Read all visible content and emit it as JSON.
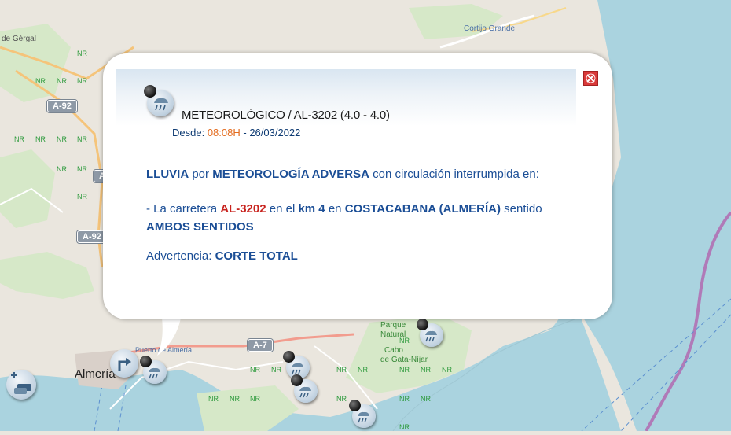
{
  "map": {
    "labels": [
      "de Gérgal",
      "Cortijo Grande",
      "Almería",
      "Puerto de Almería",
      "Parque",
      "Natural",
      "Cabo",
      "de Gata-Níjar"
    ],
    "road_shields": [
      "A-92",
      "A-92",
      "A-7",
      "A"
    ],
    "nr_label": "NR",
    "colors": {
      "land": "#eae6de",
      "sea": "#aad3df",
      "green": "#d6e8c8"
    }
  },
  "popup": {
    "icon": "rain-weather-icon",
    "title": "METEOROLÓGICO / AL-3202 (4.0 - 4.0)",
    "since_label": "Desde:",
    "since_time": "08:08H",
    "since_date": "- 26/03/2022",
    "line1": {
      "cause": "LLUVIA",
      "por": "por",
      "reason": "METEOROLOGÍA ADVERSA",
      "rest": "con circulación interrumpida en:"
    },
    "line2": {
      "prefix": "- La carretera",
      "road": "AL-3202",
      "en_el": "en el",
      "km": "km 4",
      "en": "en",
      "place": "COSTACABANA (ALMERÍA)",
      "sentido": "sentido",
      "direction": "AMBOS SENTIDOS"
    },
    "warning_label": "Advertencia:",
    "warning_value": "CORTE TOTAL",
    "close_icon": "close-icon",
    "colors": {
      "text_blue": "#1b4e96",
      "highlight_red": "#c8231e",
      "time_orange": "#e36b1e"
    }
  }
}
